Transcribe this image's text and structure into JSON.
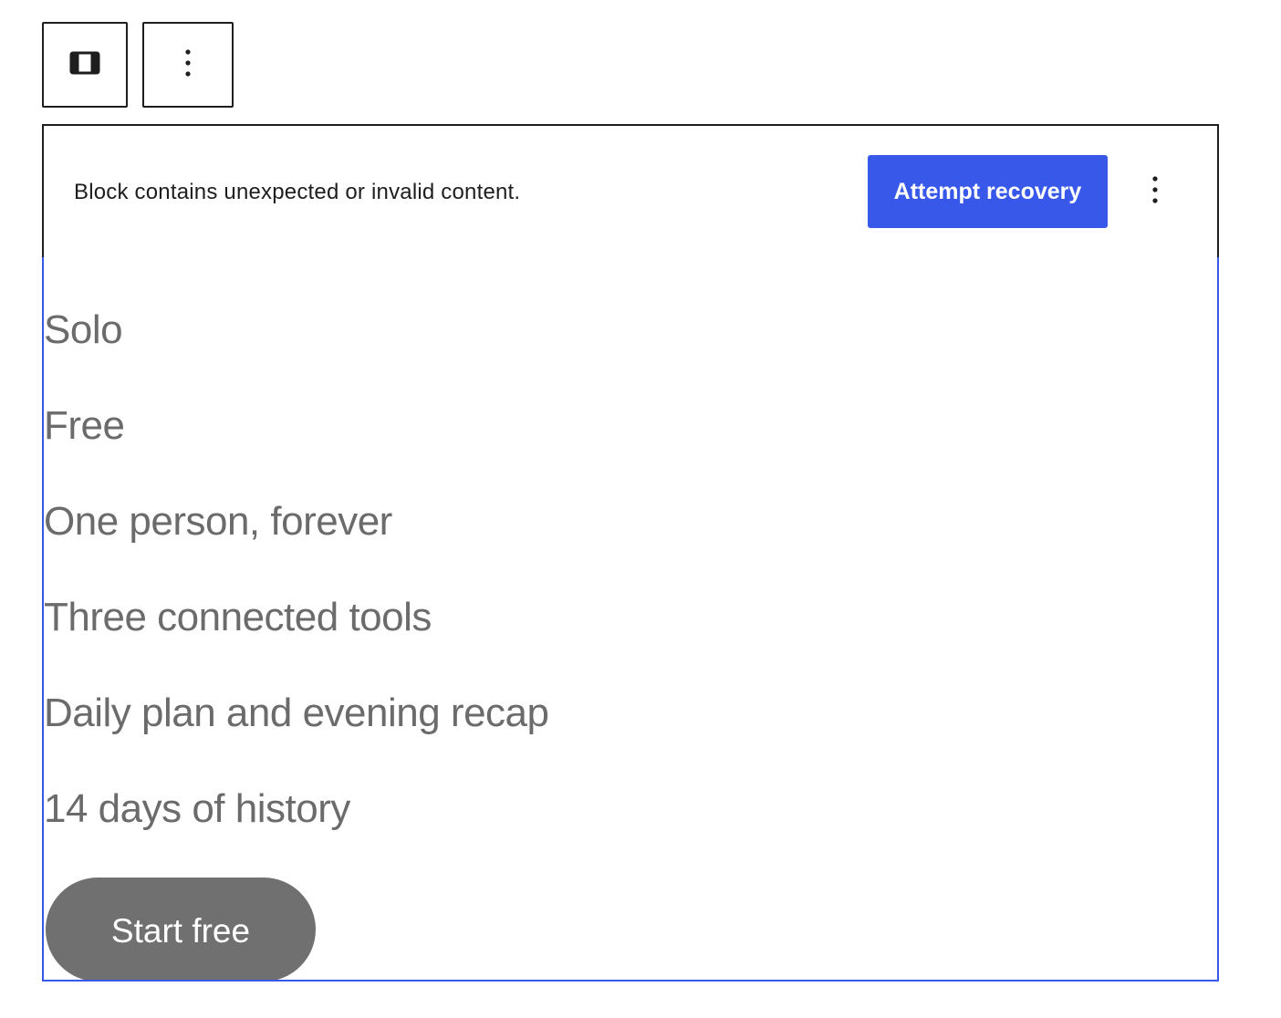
{
  "toolbar": {
    "items": [
      {
        "icon": "block-type-icon"
      },
      {
        "icon": "vertical-ellipsis-icon"
      }
    ]
  },
  "warning": {
    "message": "Block contains unexpected or invalid content.",
    "recovery_label": "Attempt recovery",
    "more_icon": "vertical-ellipsis-icon",
    "accent_color": "#3858e9"
  },
  "block": {
    "lines": [
      "Solo",
      "Free",
      "One person, forever",
      "Three connected tools",
      "Daily plan and evening recap",
      "14 days of history"
    ],
    "cta_label": "Start free",
    "border_color": "#3858e9",
    "text_color": "#6b6b6b",
    "cta_color": "#707070"
  }
}
